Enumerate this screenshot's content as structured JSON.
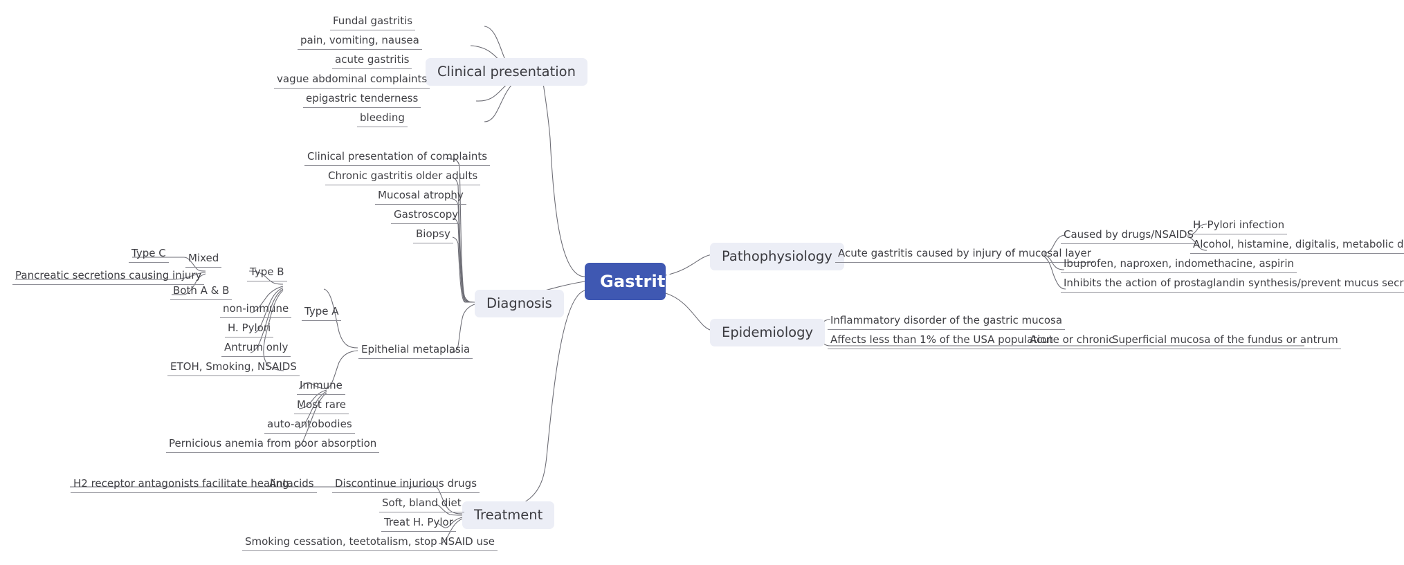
{
  "title": "Gastritis",
  "colors": {
    "root_fill": "#3F58B2",
    "root_text": "#FFFFFF",
    "branch_fill": "#ECEEF6",
    "branch_text": "#3B3B40",
    "leaf_text": "#404045",
    "link_stroke": "#6E6E76",
    "background": "#FFFFFF"
  },
  "root": {
    "label": "Gastritis"
  },
  "branches": {
    "clinical_presentation": {
      "label": "Clinical presentation",
      "children": [
        {
          "label": "Fundal gastritis"
        },
        {
          "label": "pain, vomiting, nausea"
        },
        {
          "label": "acute gastritis"
        },
        {
          "label": "vague abdominal complaints"
        },
        {
          "label": "epigastric tenderness"
        },
        {
          "label": "bleeding"
        }
      ]
    },
    "diagnosis": {
      "label": "Diagnosis",
      "children": [
        {
          "label": "Clinical presentation of complaints"
        },
        {
          "label": "Chronic gastritis older adults"
        },
        {
          "label": "Mucosal atrophy"
        },
        {
          "label": "Gastroscopy"
        },
        {
          "label": "Biopsy"
        },
        {
          "label": "Epithelial metaplasia"
        }
      ],
      "epithelial_metaplasia": {
        "label": "Epithelial metaplasia",
        "type_b": {
          "label": "Type B",
          "mixed": {
            "label": "Mixed",
            "children": [
              {
                "label": "Type C"
              },
              {
                "label": "Pancreatic secretions causing injury"
              },
              {
                "label": "Both A & B"
              }
            ]
          },
          "children": [
            {
              "label": "non-immune"
            },
            {
              "label": "H. Pylori"
            },
            {
              "label": "Antrum only"
            },
            {
              "label": "ETOH, Smoking, NSAIDS"
            }
          ]
        },
        "type_a": {
          "label": "Type A",
          "children": [
            {
              "label": "Immune"
            },
            {
              "label": "Most rare"
            },
            {
              "label": "auto-antobodies"
            },
            {
              "label": "Pernicious anemia from poor absorption"
            }
          ]
        }
      }
    },
    "treatment": {
      "label": "Treatment",
      "children": [
        {
          "label": "Discontinue injurious drugs"
        },
        {
          "label": "Soft, bland diet"
        },
        {
          "label": "Treat H. Pylor"
        },
        {
          "label": "Smoking cessation, teetotalism, stop NSAID use"
        }
      ],
      "antacids": {
        "label": "Antacids",
        "children": [
          {
            "label": "H2 receptor antagonists facilitate healing"
          }
        ]
      }
    },
    "pathophysiology": {
      "label": "Pathophysiology",
      "acute_gastritis": {
        "label": "Acute gastritis caused by injury of mucosal layer",
        "children": [
          {
            "label": "Caused by drugs/NSAIDS"
          },
          {
            "label": "Ibuprofen, naproxen, indomethacine, aspirin"
          },
          {
            "label": "Inhibits the action of prostaglandin synthesis/prevent mucus secretion"
          }
        ],
        "caused_by_drugs_children": [
          {
            "label": "H. Pylori infection"
          },
          {
            "label": "Alcohol, histamine, digitalis, metabolic disorders"
          }
        ]
      }
    },
    "epidemiology": {
      "label": "Epidemiology",
      "children": [
        {
          "label": "Inflammatory disorder of the gastric mucosa"
        },
        {
          "label": "Affects less than 1% of the USA population"
        }
      ],
      "acute_or_chronic": {
        "label": "Acute or chronic",
        "children": [
          {
            "label": "Superficial mucosa of the fundus or antrum"
          }
        ]
      }
    }
  }
}
